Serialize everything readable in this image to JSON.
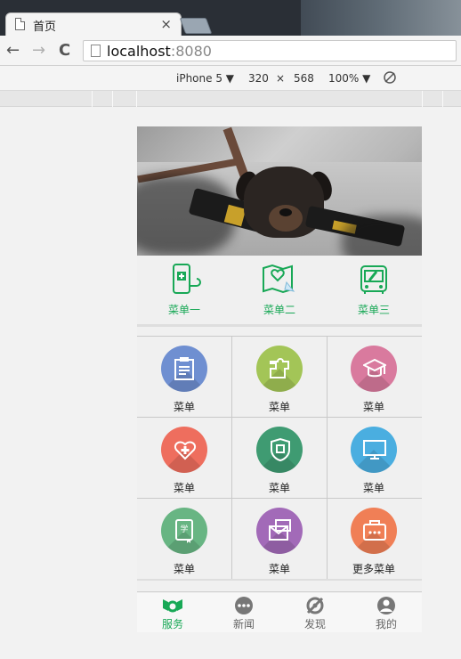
{
  "browser": {
    "tab_title": "首页",
    "tab_close": "×",
    "url_host": "localhost",
    "url_port": ":8080",
    "back": "←",
    "forward": "→",
    "reload": "C"
  },
  "device_toolbar": {
    "device": "iPhone 5 ▼",
    "width": "320",
    "times": "×",
    "height": "568",
    "zoom": "100% ▼"
  },
  "quick_menu": [
    {
      "label": "菜单一",
      "icon": "phone-hospital-icon"
    },
    {
      "label": "菜单二",
      "icon": "map-heart-icon"
    },
    {
      "label": "菜单三",
      "icon": "bus-icon"
    }
  ],
  "grid_menu": [
    {
      "label": "菜单",
      "icon": "clipboard-icon",
      "color": "#6f8fd1"
    },
    {
      "label": "菜单",
      "icon": "puzzle-icon",
      "color": "#a3c557"
    },
    {
      "label": "菜单",
      "icon": "graduation-cap-icon",
      "color": "#d97a9e"
    },
    {
      "label": "菜单",
      "icon": "heart-cross-icon",
      "color": "#ee6e5e"
    },
    {
      "label": "菜单",
      "icon": "shield-icon",
      "color": "#3f9b72"
    },
    {
      "label": "菜单",
      "icon": "monitor-icon",
      "color": "#4aaee0"
    },
    {
      "label": "菜单",
      "icon": "book-icon",
      "color": "#68b583"
    },
    {
      "label": "菜单",
      "icon": "envelope-icon",
      "color": "#a26ab8"
    },
    {
      "label": "更多菜单",
      "icon": "toolbox-icon",
      "color": "#f07f56"
    }
  ],
  "book_glyph": "学",
  "tabbar": [
    {
      "label": "服务",
      "icon": "service-icon",
      "active": true
    },
    {
      "label": "新闻",
      "icon": "news-icon",
      "active": false
    },
    {
      "label": "发现",
      "icon": "discover-icon",
      "active": false
    },
    {
      "label": "我的",
      "icon": "profile-icon",
      "active": false
    }
  ],
  "colors": {
    "accent": "#18a856"
  }
}
